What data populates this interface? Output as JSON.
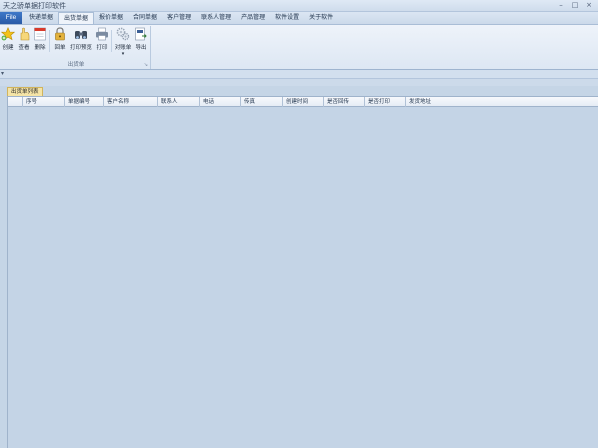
{
  "window": {
    "title": "天之骄单据打印软件",
    "controls": [
      "–",
      "□",
      "×"
    ]
  },
  "menu": {
    "file_label": "File",
    "tabs": [
      "快递单据",
      "出货单据",
      "报价单据",
      "合同单据",
      "客户管理",
      "联系人管理",
      "产品管理",
      "软件设置",
      "关于软件"
    ],
    "active_tab": "出货单据"
  },
  "ribbon": {
    "group_label": "出货单",
    "launcher": "↘",
    "buttons": {
      "create": "创建",
      "view": "查看",
      "delete": "删除",
      "lock": "回单",
      "print_preview": "打印预览",
      "print": "打印",
      "compare": "对账单",
      "export": "导出"
    },
    "dropdown_marker": "▾"
  },
  "quick_access": {
    "arrow": "▾"
  },
  "document": {
    "tab_label": "出货单列表",
    "columns": [
      "序号",
      "单据编号",
      "客户名称",
      "联系人",
      "电话",
      "传真",
      "创建时间",
      "是否回传",
      "是否打印",
      "发货地址"
    ]
  }
}
